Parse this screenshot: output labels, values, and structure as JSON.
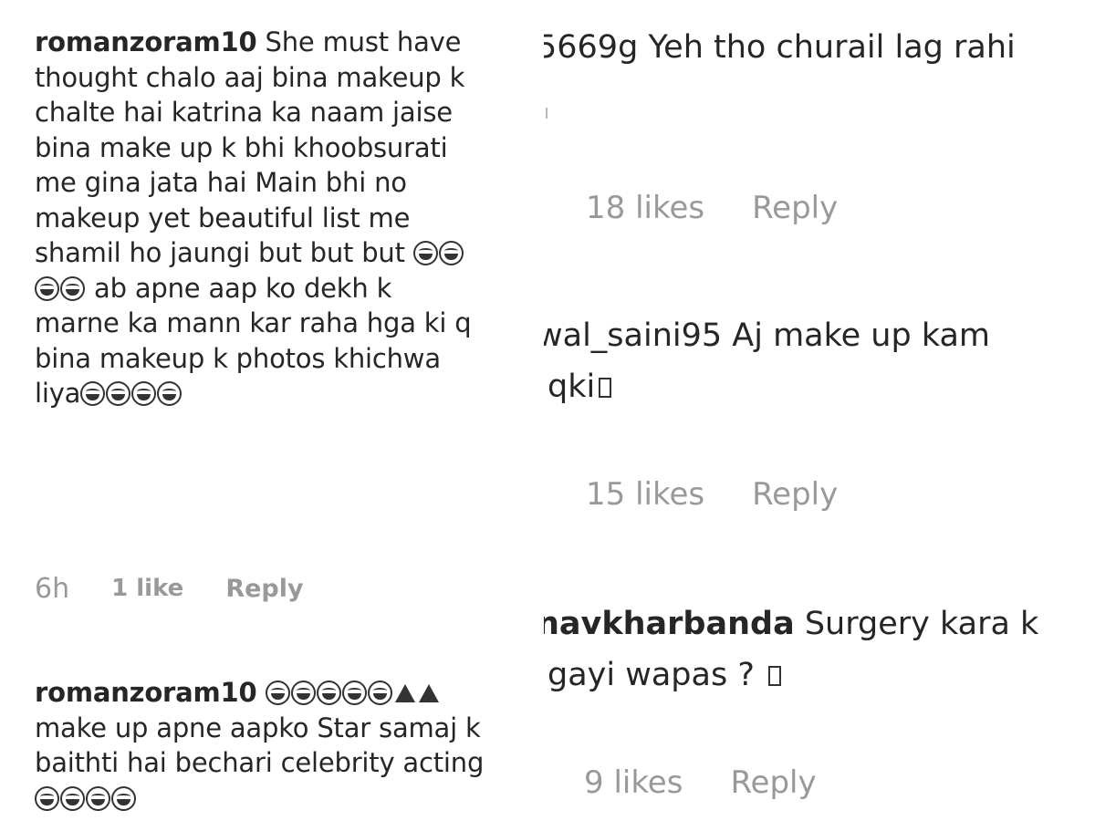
{
  "left_comments": [
    {
      "username": "romanzoram10",
      "lines": [
        "She must have",
        "thought chalo aaj bina makeup k",
        "chalte hai katrina ka naam jaise",
        "bina make up k bhi khoobsurati",
        "me gina jata hai Main bhi no",
        "makeup yet beautiful list me",
        "shamil ho jaungi but but but",
        "ab apne aap ko dekh k",
        "marne ka mann kar raha hga ki q",
        "bina makeup k photos khichwa",
        "liya"
      ],
      "time": "6h",
      "likes": "1 like",
      "reply": "Reply"
    },
    {
      "username": "romanzoram10",
      "lines": [
        "make up apne aapko Star samaj k",
        "baithti hai bechari celebrity acting"
      ]
    }
  ],
  "right_comments": [
    {
      "username": "5669g",
      "text": "Yeh tho churail lag rahi",
      "likes": "18 likes",
      "reply": "Reply"
    },
    {
      "username": "wal_saini95",
      "text": "Aj make up kam",
      "line2": "qki",
      "likes": "15 likes",
      "reply": "Reply"
    },
    {
      "username": "navkharbanda",
      "text": "Surgery kara k",
      "line2": "gayi wapas ?",
      "likes": "9 likes",
      "reply": "Reply"
    }
  ],
  "icons": {
    "laugh_emoji": "face-with-tears-of-joy-icon",
    "poop_emoji": "pile-of-poo-icon",
    "missing_glyph": "missing-glyph-box-icon"
  }
}
